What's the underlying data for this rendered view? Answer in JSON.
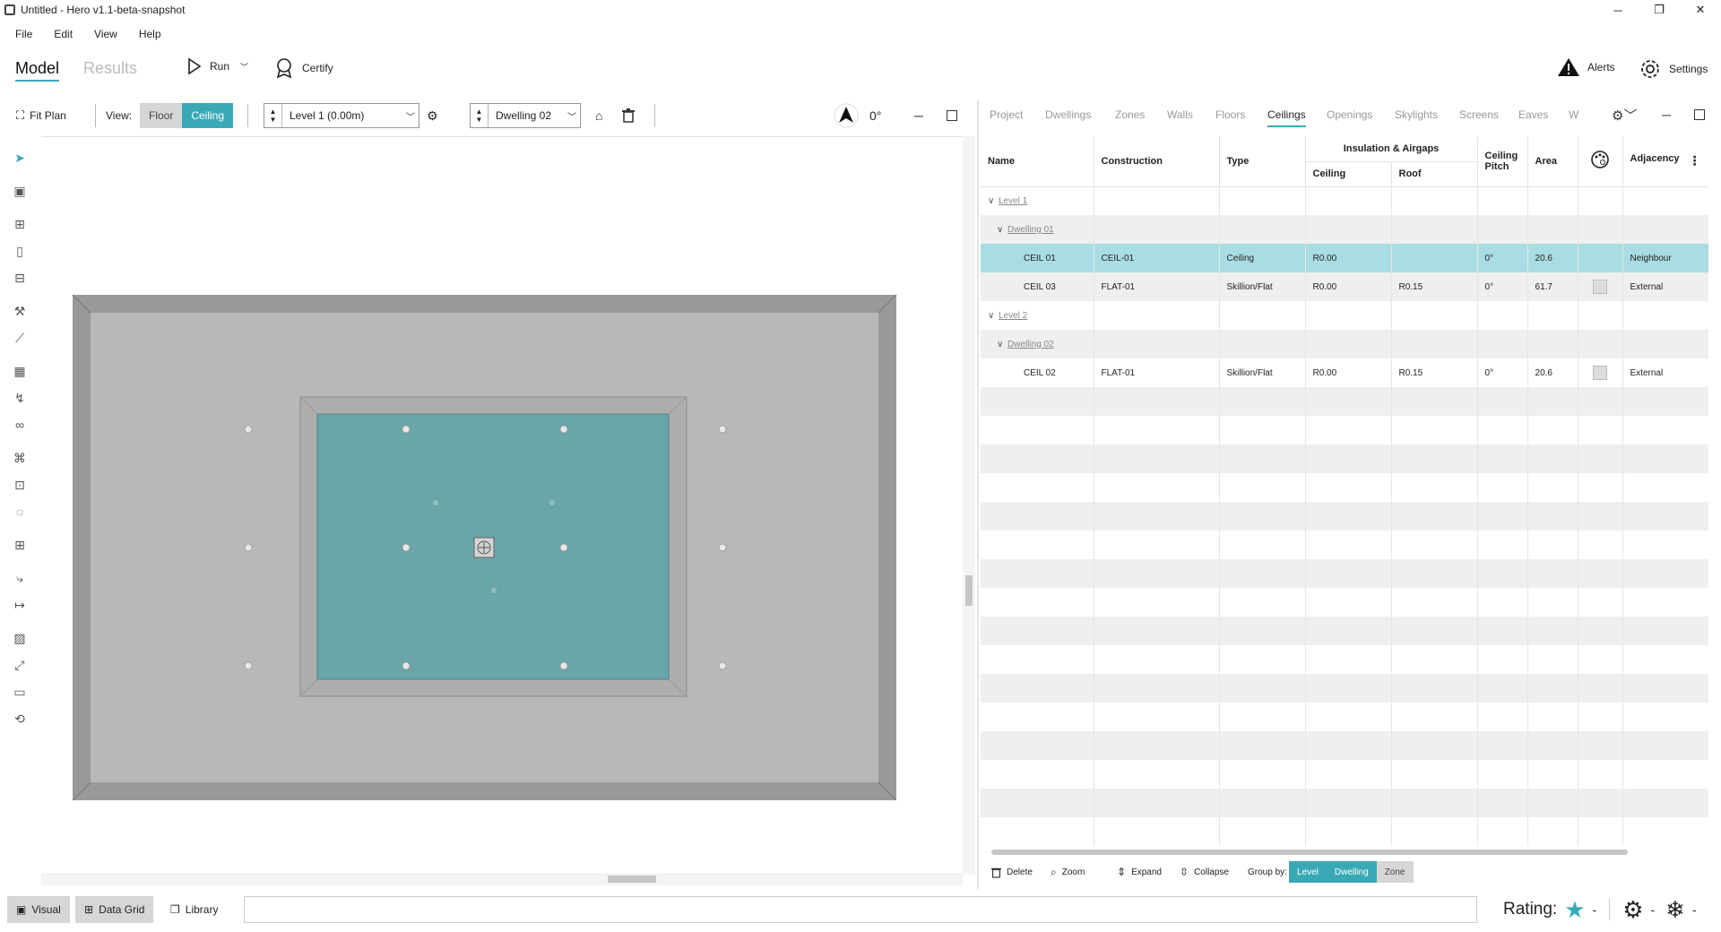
{
  "window": {
    "title": "Untitled - Hero v1.1-beta-snapshot",
    "minimize": "─",
    "restore": "❐",
    "close": "✕"
  },
  "menu": [
    "File",
    "Edit",
    "View",
    "Help"
  ],
  "mode_tabs": {
    "model": "Model",
    "results": "Results"
  },
  "commands": {
    "run": "Run",
    "certify": "Certify",
    "alerts": "Alerts",
    "settings": "Settings"
  },
  "canvas_toolbar": {
    "fit_plan": "Fit Plan",
    "view_label": "View:",
    "view_floor": "Floor",
    "view_ceiling": "Ceiling",
    "view_selected": "Ceiling",
    "level_value": "Level 1 (0.00m)",
    "dwelling_value": "Dwelling 02",
    "north_angle": "0°"
  },
  "right_tabs": [
    "Project",
    "Dwellings",
    "Zones",
    "Walls",
    "Floors",
    "Ceilings",
    "Openings",
    "Skylights",
    "Screens",
    "Eaves",
    "W"
  ],
  "active_tab": "Ceilings",
  "grid": {
    "headers": {
      "name": "Name",
      "construction": "Construction",
      "type": "Type",
      "insulation": "Insulation & Airgaps",
      "ceiling": "Ceiling",
      "roof": "Roof",
      "pitch": "Ceiling Pitch",
      "area": "Area",
      "adjacency": "Adjacency"
    },
    "groups": {
      "level1": "Level 1",
      "dwelling1": "Dwelling 01",
      "level2": "Level 2",
      "dwelling2": "Dwelling 02"
    },
    "rows": [
      {
        "name": "CEIL 01",
        "construction": "CEIL-01",
        "type": "Ceiling",
        "ceiling": "R0.00",
        "roof": "",
        "pitch": "0°",
        "area": "20.6",
        "adjacency": "Neighbour"
      },
      {
        "name": "CEIL 03",
        "construction": "FLAT-01",
        "type": "Skillion/Flat",
        "ceiling": "R0.00",
        "roof": "R0.15",
        "pitch": "0°",
        "area": "61.7",
        "adjacency": "External"
      },
      {
        "name": "CEIL 02",
        "construction": "FLAT-01",
        "type": "Skillion/Flat",
        "ceiling": "R0.00",
        "roof": "R0.15",
        "pitch": "0°",
        "area": "20.6",
        "adjacency": "External"
      }
    ]
  },
  "grid_footer": {
    "delete": "Delete",
    "zoom": "Zoom",
    "expand": "Expand",
    "collapse": "Collapse",
    "group_by": "Group by:",
    "level": "Level",
    "dwelling": "Dwelling",
    "zone": "Zone"
  },
  "statusbar": {
    "visual": "Visual",
    "data_grid": "Data Grid",
    "library": "Library",
    "rating_label": "Rating:",
    "rating_value": "-",
    "heating_value": "-",
    "cooling_value": "-"
  },
  "colors": {
    "accent": "#3aa9b6",
    "room_fill": "#6aa5a8",
    "floor_gray": "#b8b8b8",
    "wall_gray": "#999999"
  }
}
